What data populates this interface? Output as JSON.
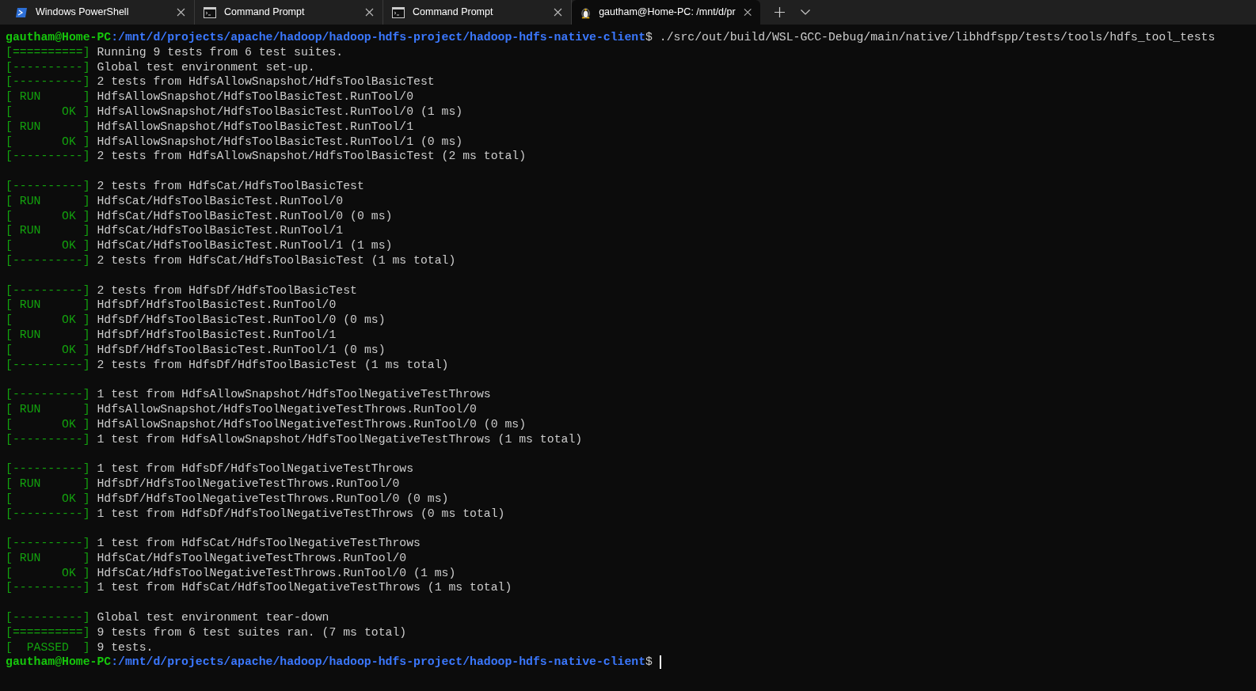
{
  "tabs": [
    {
      "title": "Windows PowerShell",
      "kind": "powershell",
      "selected": false
    },
    {
      "title": "Command Prompt",
      "kind": "cmd",
      "selected": false
    },
    {
      "title": "Command Prompt",
      "kind": "cmd",
      "selected": false
    },
    {
      "title": "gautham@Home-PC: /mnt/d/pr",
      "kind": "linux",
      "selected": true
    }
  ],
  "lines": [
    {
      "kind": "prompt",
      "user": "gautham@Home-PC",
      "path": ":/mnt/d/projects/apache/hadoop/hadoop-hdfs-project/hadoop-hdfs-native-client",
      "symbol": "$",
      "command": " ./src/out/build/WSL-GCC-Debug/main/native/libhdfspp/tests/tools/hdfs_tool_tests"
    },
    {
      "kind": "test",
      "tag": "[==========]",
      "text": "Running 9 tests from 6 test suites."
    },
    {
      "kind": "test",
      "tag": "[----------]",
      "text": "Global test environment set-up."
    },
    {
      "kind": "test",
      "tag": "[----------]",
      "text": "2 tests from HdfsAllowSnapshot/HdfsToolBasicTest"
    },
    {
      "kind": "test",
      "tag": "[ RUN      ]",
      "text": "HdfsAllowSnapshot/HdfsToolBasicTest.RunTool/0"
    },
    {
      "kind": "test",
      "tag": "[       OK ]",
      "text": "HdfsAllowSnapshot/HdfsToolBasicTest.RunTool/0 (1 ms)"
    },
    {
      "kind": "test",
      "tag": "[ RUN      ]",
      "text": "HdfsAllowSnapshot/HdfsToolBasicTest.RunTool/1"
    },
    {
      "kind": "test",
      "tag": "[       OK ]",
      "text": "HdfsAllowSnapshot/HdfsToolBasicTest.RunTool/1 (0 ms)"
    },
    {
      "kind": "test",
      "tag": "[----------]",
      "text": "2 tests from HdfsAllowSnapshot/HdfsToolBasicTest (2 ms total)"
    },
    {
      "kind": "blank"
    },
    {
      "kind": "test",
      "tag": "[----------]",
      "text": "2 tests from HdfsCat/HdfsToolBasicTest"
    },
    {
      "kind": "test",
      "tag": "[ RUN      ]",
      "text": "HdfsCat/HdfsToolBasicTest.RunTool/0"
    },
    {
      "kind": "test",
      "tag": "[       OK ]",
      "text": "HdfsCat/HdfsToolBasicTest.RunTool/0 (0 ms)"
    },
    {
      "kind": "test",
      "tag": "[ RUN      ]",
      "text": "HdfsCat/HdfsToolBasicTest.RunTool/1"
    },
    {
      "kind": "test",
      "tag": "[       OK ]",
      "text": "HdfsCat/HdfsToolBasicTest.RunTool/1 (1 ms)"
    },
    {
      "kind": "test",
      "tag": "[----------]",
      "text": "2 tests from HdfsCat/HdfsToolBasicTest (1 ms total)"
    },
    {
      "kind": "blank"
    },
    {
      "kind": "test",
      "tag": "[----------]",
      "text": "2 tests from HdfsDf/HdfsToolBasicTest"
    },
    {
      "kind": "test",
      "tag": "[ RUN      ]",
      "text": "HdfsDf/HdfsToolBasicTest.RunTool/0"
    },
    {
      "kind": "test",
      "tag": "[       OK ]",
      "text": "HdfsDf/HdfsToolBasicTest.RunTool/0 (0 ms)"
    },
    {
      "kind": "test",
      "tag": "[ RUN      ]",
      "text": "HdfsDf/HdfsToolBasicTest.RunTool/1"
    },
    {
      "kind": "test",
      "tag": "[       OK ]",
      "text": "HdfsDf/HdfsToolBasicTest.RunTool/1 (0 ms)"
    },
    {
      "kind": "test",
      "tag": "[----------]",
      "text": "2 tests from HdfsDf/HdfsToolBasicTest (1 ms total)"
    },
    {
      "kind": "blank"
    },
    {
      "kind": "test",
      "tag": "[----------]",
      "text": "1 test from HdfsAllowSnapshot/HdfsToolNegativeTestThrows"
    },
    {
      "kind": "test",
      "tag": "[ RUN      ]",
      "text": "HdfsAllowSnapshot/HdfsToolNegativeTestThrows.RunTool/0"
    },
    {
      "kind": "test",
      "tag": "[       OK ]",
      "text": "HdfsAllowSnapshot/HdfsToolNegativeTestThrows.RunTool/0 (0 ms)"
    },
    {
      "kind": "test",
      "tag": "[----------]",
      "text": "1 test from HdfsAllowSnapshot/HdfsToolNegativeTestThrows (1 ms total)"
    },
    {
      "kind": "blank"
    },
    {
      "kind": "test",
      "tag": "[----------]",
      "text": "1 test from HdfsDf/HdfsToolNegativeTestThrows"
    },
    {
      "kind": "test",
      "tag": "[ RUN      ]",
      "text": "HdfsDf/HdfsToolNegativeTestThrows.RunTool/0"
    },
    {
      "kind": "test",
      "tag": "[       OK ]",
      "text": "HdfsDf/HdfsToolNegativeTestThrows.RunTool/0 (0 ms)"
    },
    {
      "kind": "test",
      "tag": "[----------]",
      "text": "1 test from HdfsDf/HdfsToolNegativeTestThrows (0 ms total)"
    },
    {
      "kind": "blank"
    },
    {
      "kind": "test",
      "tag": "[----------]",
      "text": "1 test from HdfsCat/HdfsToolNegativeTestThrows"
    },
    {
      "kind": "test",
      "tag": "[ RUN      ]",
      "text": "HdfsCat/HdfsToolNegativeTestThrows.RunTool/0"
    },
    {
      "kind": "test",
      "tag": "[       OK ]",
      "text": "HdfsCat/HdfsToolNegativeTestThrows.RunTool/0 (1 ms)"
    },
    {
      "kind": "test",
      "tag": "[----------]",
      "text": "1 test from HdfsCat/HdfsToolNegativeTestThrows (1 ms total)"
    },
    {
      "kind": "blank"
    },
    {
      "kind": "test",
      "tag": "[----------]",
      "text": "Global test environment tear-down"
    },
    {
      "kind": "test",
      "tag": "[==========]",
      "text": "9 tests from 6 test suites ran. (7 ms total)"
    },
    {
      "kind": "test",
      "tag": "[  PASSED  ]",
      "text": "9 tests."
    },
    {
      "kind": "prompt",
      "user": "gautham@Home-PC",
      "path": ":/mnt/d/projects/apache/hadoop/hadoop-hdfs-project/hadoop-hdfs-native-client",
      "symbol": "$",
      "cursor": true
    }
  ]
}
